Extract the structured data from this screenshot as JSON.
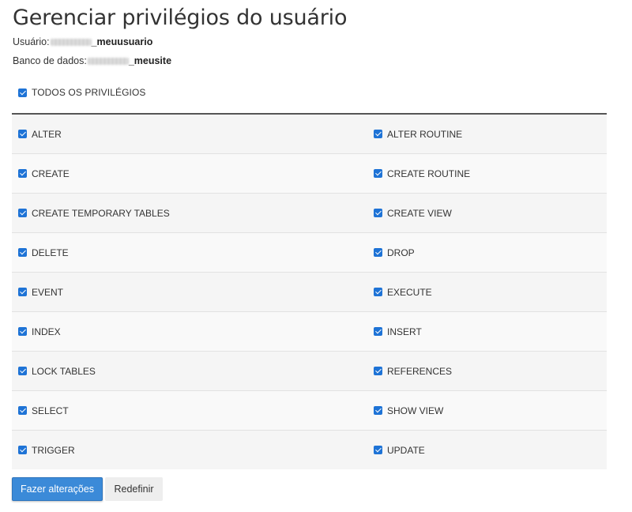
{
  "page": {
    "title": "Gerenciar privilégios do usuário",
    "user_label": "Usuário:",
    "user_value": "_meuusuario",
    "db_label": "Banco de dados:",
    "db_value": "_meusite"
  },
  "all_privileges": {
    "label": "TODOS OS PRIVILÉGIOS",
    "checked": true
  },
  "privileges": [
    {
      "left": "ALTER",
      "right": "ALTER ROUTINE"
    },
    {
      "left": "CREATE",
      "right": "CREATE ROUTINE"
    },
    {
      "left": "CREATE TEMPORARY TABLES",
      "right": "CREATE VIEW"
    },
    {
      "left": "DELETE",
      "right": "DROP"
    },
    {
      "left": "EVENT",
      "right": "EXECUTE"
    },
    {
      "left": "INDEX",
      "right": "INSERT"
    },
    {
      "left": "LOCK TABLES",
      "right": "REFERENCES"
    },
    {
      "left": "SELECT",
      "right": "SHOW VIEW"
    },
    {
      "left": "TRIGGER",
      "right": "UPDATE"
    }
  ],
  "buttons": {
    "apply": "Fazer alterações",
    "reset": "Redefinir"
  },
  "colors": {
    "checkbox": "#1e73d6",
    "primary_button": "#3b8ad8"
  }
}
